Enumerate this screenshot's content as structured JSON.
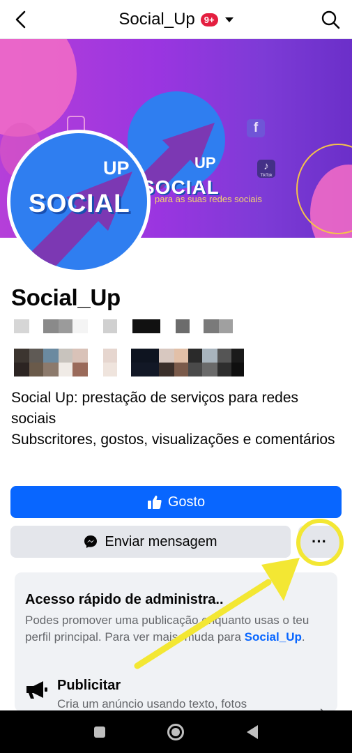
{
  "header": {
    "title": "Social_Up",
    "badge": "9+",
    "back_icon": "chevron-left-icon",
    "search_icon": "search-icon"
  },
  "cover": {
    "logo_text_top": "UP",
    "logo_text_main": "SOCIAL",
    "tagline": "para as suas redes sociais",
    "tiktok_label": "TikTok"
  },
  "avatar": {
    "text_top": "UP",
    "text_main": "SOCIAL"
  },
  "profile": {
    "name": "Social_Up",
    "bio": "Social Up: prestação de serviços para redes sociais\nSubscritores, gostos, visualizações e comentários"
  },
  "actions": {
    "like_label": "Gosto",
    "message_label": "Enviar mensagem",
    "more_label": "···"
  },
  "admin": {
    "title": "Acesso rápido de administra",
    "title_tail": "..",
    "desc_before": "Podes promover uma publica",
    "desc_gap": "ção",
    "desc_mid": " enquanto usas o teu perfil principal. Para ",
    "desc_after": "ver mais, muda para ",
    "desc_link": "Social_Up",
    "desc_end": ".",
    "advertise_title": "Publicitar",
    "advertise_desc": "Cria um anúncio usando texto, fotos"
  },
  "colors": {
    "brand_blue": "#0866ff",
    "badge_red": "#e41e3f",
    "highlight_yellow": "#f3e733"
  }
}
